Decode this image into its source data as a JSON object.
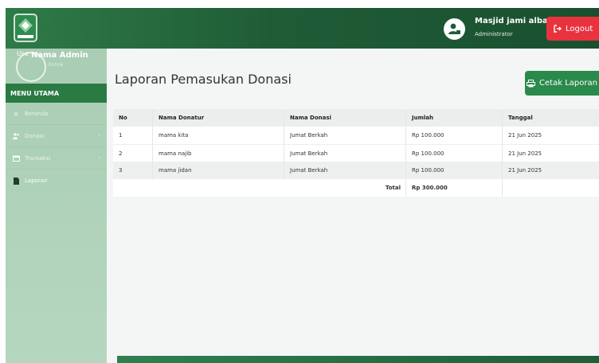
{
  "header": {
    "user_name": "Masjid jami albarok...",
    "user_role": "Administrator",
    "logout_label": "Logout"
  },
  "sidebar": {
    "avatar_alt": "Use",
    "profile_name": "Nama Admin",
    "profile_status": "Online",
    "menu_header": "MENU UTAMA",
    "items": [
      {
        "label": "Beranda"
      },
      {
        "label": "Donasi"
      },
      {
        "label": "Transaksi"
      },
      {
        "label": "Laporan"
      }
    ]
  },
  "main": {
    "title": "Laporan Pemasukan Donasi",
    "print_label": "Cetak Laporan",
    "table": {
      "headers": [
        "No",
        "Nama Donatur",
        "Nama Donasi",
        "Jumlah",
        "Tanggal"
      ],
      "rows": [
        [
          "1",
          "mama kita",
          "Jumat Berkah",
          "Rp 100.000",
          "21 Jun 2025"
        ],
        [
          "2",
          "mama najib",
          "Jumat Berkah",
          "Rp 100.000",
          "21 Jun 2025"
        ],
        [
          "3",
          "mama jidan",
          "Jumat Berkah",
          "Rp 100.000",
          "21 Jun 2025"
        ]
      ],
      "total_label": "Total",
      "total_value": "Rp 300.000"
    }
  },
  "colors": {
    "brand_green": "#2a7a44",
    "logout_red": "#e8333f",
    "print_green": "#2a8a4b"
  }
}
